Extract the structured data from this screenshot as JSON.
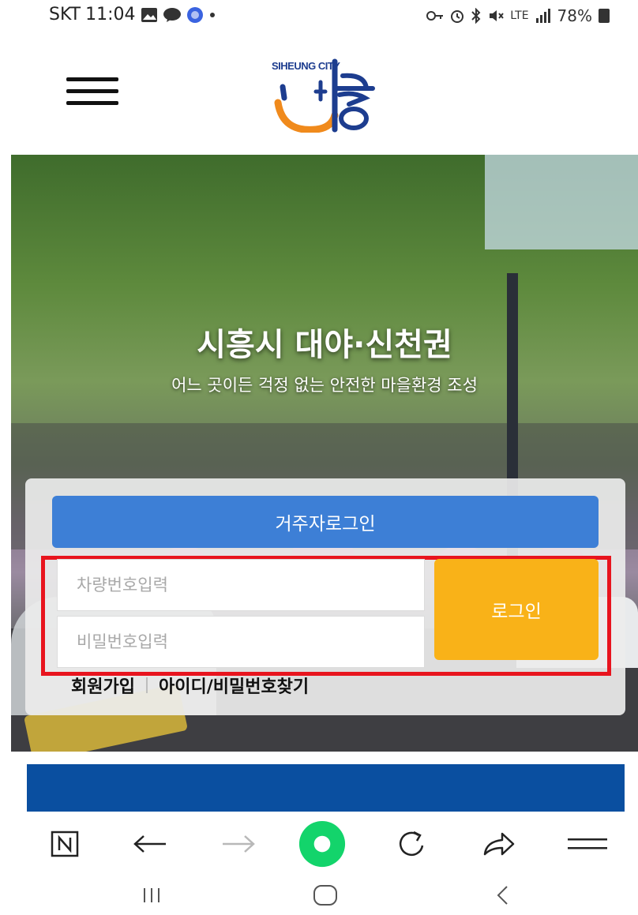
{
  "status_bar": {
    "carrier": "SKT",
    "time": "11:04",
    "network": "LTE",
    "battery": "78%"
  },
  "logo": {
    "text": "SIHEUNG CITY",
    "brand_colors": {
      "blue": "#1d3d8f",
      "orange": "#f08a1c"
    }
  },
  "hero": {
    "title": "시흥시 대야·신천권",
    "subtitle": "어느 곳이든 걱정 없는 안전한 마을환경 조성"
  },
  "login": {
    "resident_login_label": "거주자로그인",
    "car_number_placeholder": "차량번호입력",
    "password_placeholder": "비밀번호입력",
    "login_button_label": "로그인",
    "signup_link": "회원가입",
    "find_account_link": "아이디/비밀번호찾기",
    "colors": {
      "resident_button": "#3d7fd6",
      "login_button": "#f9b218",
      "highlight": "#e8141e"
    }
  },
  "browser_toolbar": {
    "items": [
      "naver-icon",
      "back-icon",
      "forward-icon",
      "home-icon",
      "refresh-icon",
      "share-icon",
      "menu-icon"
    ]
  },
  "system_nav": {
    "items": [
      "recent-apps-icon",
      "home-button-icon",
      "back-nav-icon"
    ]
  }
}
